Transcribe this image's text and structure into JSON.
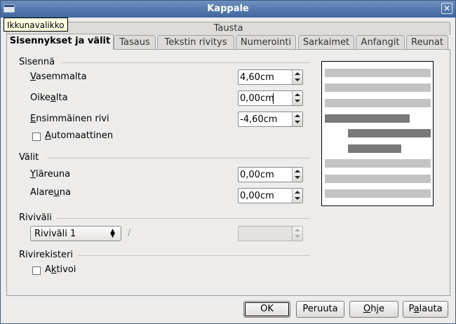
{
  "window": {
    "title": "Kappale",
    "menu_tooltip": "Ikkunavalikko",
    "close_glyph": "✕"
  },
  "tabs_row_top": [
    {
      "label": "Tausta"
    }
  ],
  "tabs": [
    {
      "label": "Sisennykset ja välit",
      "active": true
    },
    {
      "label": "Tasaus"
    },
    {
      "label": "Tekstin rivitys"
    },
    {
      "label": "Numerointi"
    },
    {
      "label": "Sarkaimet"
    },
    {
      "label": "Anfangit"
    },
    {
      "label": "Reunat"
    }
  ],
  "indent": {
    "section_label": "Sisennä",
    "left": {
      "label_pre": "",
      "label_u": "V",
      "label_post": "asemmalta",
      "value": "4,60cm"
    },
    "right": {
      "label_pre": "Oike",
      "label_u": "a",
      "label_post": "lta",
      "value": "0,00cm"
    },
    "first_line": {
      "label_pre": "",
      "label_u": "E",
      "label_post": "nsimmäinen rivi",
      "value": "-4,60cm"
    },
    "automatic": {
      "label_pre": "",
      "label_u": "A",
      "label_post": "utomaattinen",
      "checked": false
    }
  },
  "spacing": {
    "section_label": "Välit",
    "above": {
      "label_pre": "",
      "label_u": "Y",
      "label_post": "läreuna",
      "value": "0,00cm"
    },
    "below": {
      "label_pre": "Alare",
      "label_u": "u",
      "label_post": "na",
      "value": "0,00cm"
    }
  },
  "line_spacing": {
    "section_label": "Riviväli",
    "select_value": "Riviväli 1",
    "separator": "/",
    "amount_value": ""
  },
  "register": {
    "section_label": "Rivirekisteri",
    "activate": {
      "label_pre": "A",
      "label_u": "k",
      "label_post": "tivoi",
      "checked": false
    }
  },
  "preview_colors": {
    "light": "#c3c3c3",
    "dark": "#7a7a7a"
  },
  "buttons": {
    "ok": {
      "label_pre": "OK",
      "label_u": "",
      "label_post": ""
    },
    "cancel": {
      "label_pre": "Peruuta",
      "label_u": "",
      "label_post": ""
    },
    "help": {
      "label_pre": "",
      "label_u": "O",
      "label_post": "hje"
    },
    "reset": {
      "label_pre": "P",
      "label_u": "a",
      "label_post": "lauta"
    }
  },
  "icons": {
    "window_menu": "window-menu-icon",
    "close": "close-icon",
    "spin": "spin-arrows-icon",
    "dropdown": "dropdown-arrows-icon"
  }
}
